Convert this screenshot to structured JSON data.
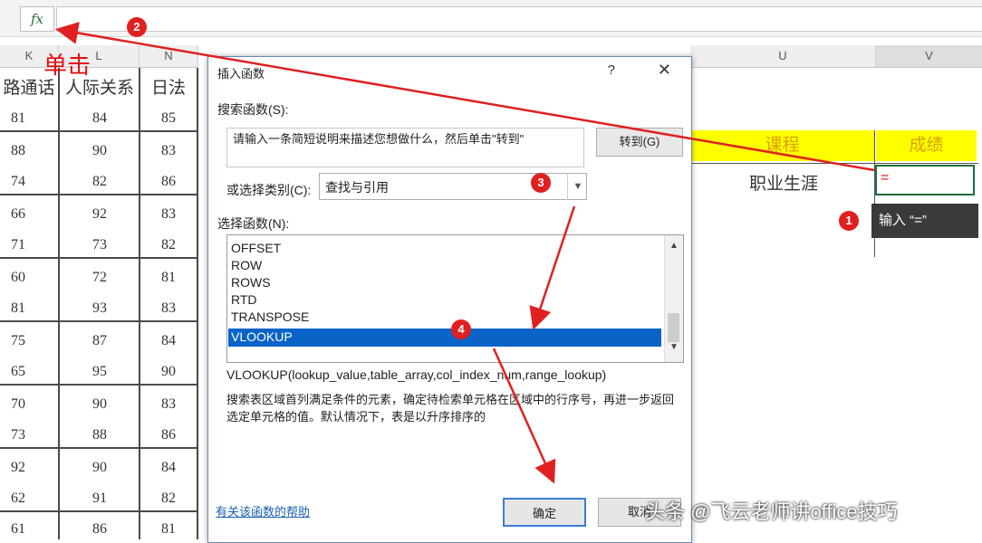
{
  "formula_bar": {
    "fx_label": "fx"
  },
  "columns": {
    "k": "K",
    "l": "L",
    "n": "N",
    "u": "U",
    "v": "V"
  },
  "sheet_headers": {
    "col1": "路通话",
    "col2": "人际关系",
    "col3": "日法"
  },
  "rows": [
    [
      "81",
      "84",
      "85"
    ],
    [
      "88",
      "90",
      "83"
    ],
    [
      "74",
      "82",
      "86"
    ],
    [
      "66",
      "92",
      "83"
    ],
    [
      "71",
      "73",
      "82"
    ],
    [
      "60",
      "72",
      "81"
    ],
    [
      "81",
      "93",
      "83"
    ],
    [
      "75",
      "87",
      "84"
    ],
    [
      "65",
      "95",
      "90"
    ],
    [
      "70",
      "90",
      "83"
    ],
    [
      "73",
      "88",
      "86"
    ],
    [
      "92",
      "90",
      "84"
    ],
    [
      "62",
      "91",
      "82"
    ],
    [
      "61",
      "86",
      "81"
    ]
  ],
  "right_table": {
    "course_header": "课程",
    "score_header": "成绩",
    "course_value": "职业生涯",
    "score_value": "="
  },
  "tooltip": "输入 “=”",
  "annotation_click": "单击",
  "markers": {
    "m1": "1",
    "m2": "2",
    "m3": "3",
    "m4": "4"
  },
  "dialog": {
    "title": "插入函数",
    "help_symbol": "?",
    "close_symbol": "✕",
    "search_label": "搜索函数(S):",
    "search_value": "请输入一条简短说明来描述您想做什么，然后单击\"转到\"",
    "go_button": "转到(G)",
    "category_label": "或选择类别(C):",
    "category_value": "查找与引用",
    "list_label": "选择函数(N):",
    "functions": [
      "OFFSET",
      "ROW",
      "ROWS",
      "RTD",
      "TRANSPOSE",
      "VLOOKUP"
    ],
    "selected_function": "VLOOKUP",
    "syntax": "VLOOKUP(lookup_value,table_array,col_index_num,range_lookup)",
    "description": "搜索表区域首列满足条件的元素，确定待检索单元格在区域中的行序号，再进一步返回选定单元格的值。默认情况下，表是以升序排序的",
    "help_link": "有关该函数的帮助",
    "ok_button": "确定",
    "cancel_button": "取消"
  },
  "watermark": "头条 @飞云老师讲office技巧",
  "colors": {
    "selection": "#0a64c8",
    "arrow": "#e02020",
    "highlight": "#ffff00"
  }
}
